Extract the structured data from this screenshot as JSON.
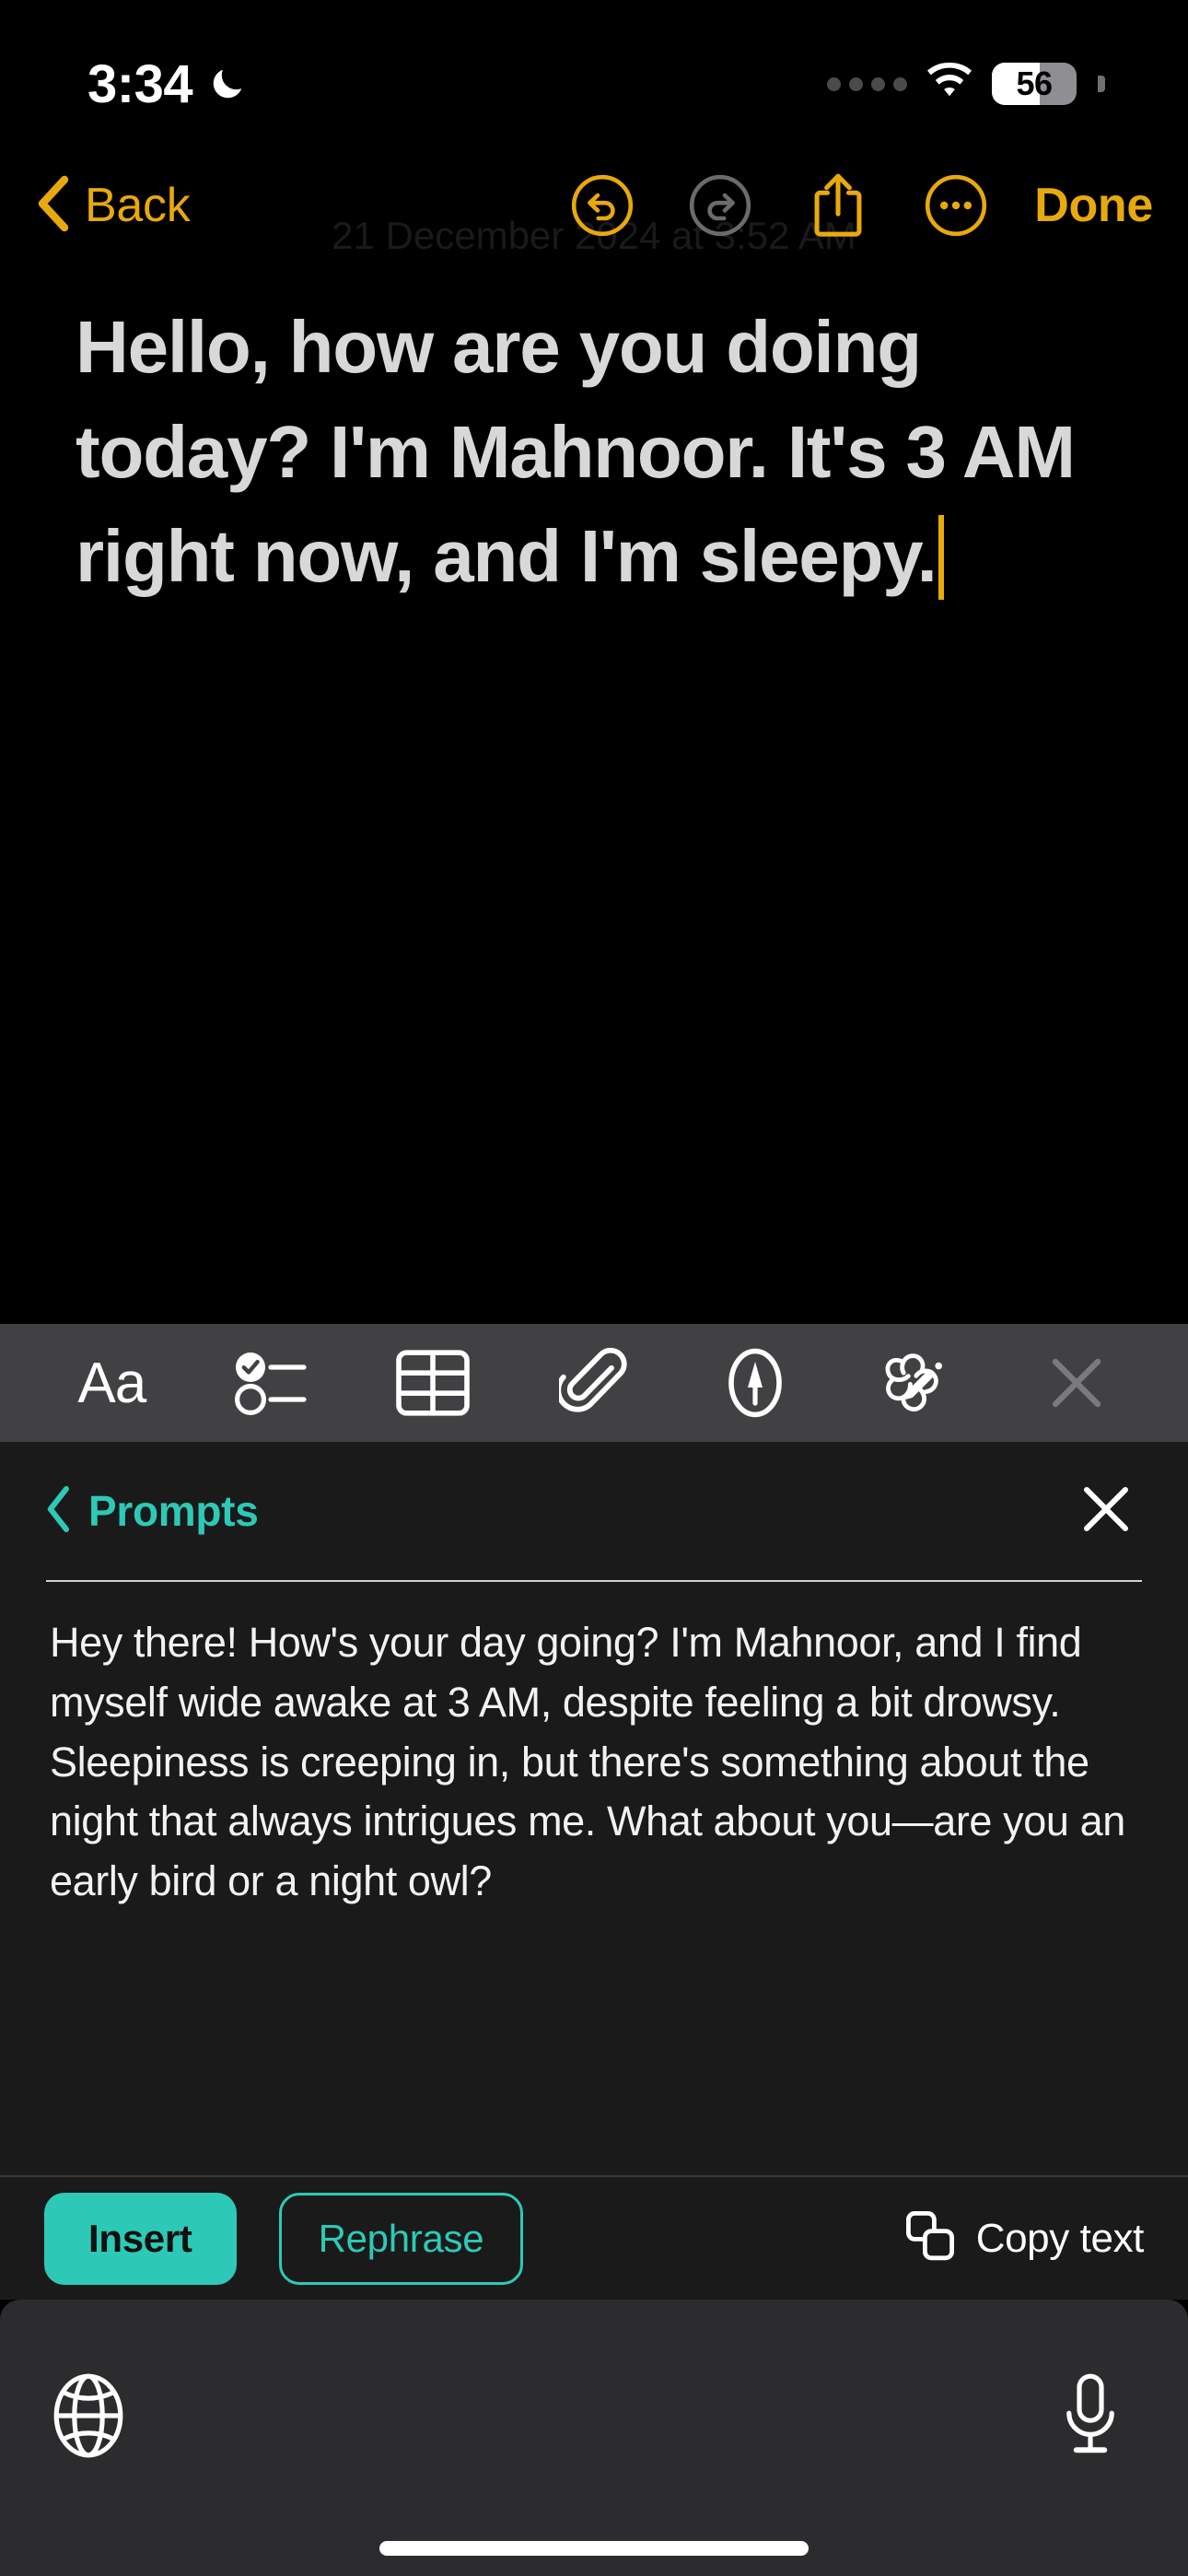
{
  "status_bar": {
    "time": "3:34",
    "do_not_disturb_icon": "moon-icon",
    "cellular_icon": "cellular-dots-icon",
    "wifi_icon": "wifi-icon",
    "battery_percent": "56",
    "battery_level": 56
  },
  "note_toolbar": {
    "back_label": "Back",
    "undo_icon": "undo-circle-icon",
    "redo_icon": "redo-circle-icon",
    "share_icon": "share-icon",
    "more_icon": "more-ellipsis-icon",
    "done_label": "Done",
    "accent_color": "#e8a90c",
    "undo_enabled": true,
    "redo_enabled": false
  },
  "note": {
    "date_stamp": "21 December 2024 at 3:52 AM",
    "body": "Hello, how are you doing today? I'm Mahnoor. It's 3 AM right now, and I'm sleepy.",
    "caret_color": "#e8a90c"
  },
  "format_toolbar": {
    "items": [
      {
        "label": "Aa",
        "icon": "text-format-icon"
      },
      {
        "label": "",
        "icon": "checklist-icon"
      },
      {
        "label": "",
        "icon": "table-icon"
      },
      {
        "label": "",
        "icon": "paperclip-icon"
      },
      {
        "label": "",
        "icon": "markup-pen-icon"
      },
      {
        "label": "",
        "icon": "scribble-ai-icon"
      },
      {
        "label": "",
        "icon": "close-icon"
      }
    ]
  },
  "prompts_panel": {
    "back_icon": "chevron-left-icon",
    "title": "Prompts",
    "close_icon": "close-icon",
    "accent_color": "#2ec9b6",
    "response_text": "Hey there! How's your day going? I'm Mahnoor, and I find myself wide awake at 3 AM, despite feeling a bit drowsy. Sleepiness is creeping in, but there's something about the night that always intrigues me. What about you—are you an early bird or a night owl?"
  },
  "action_bar": {
    "insert_label": "Insert",
    "rephrase_label": "Rephrase",
    "copy_label": "Copy text",
    "copy_icon": "copy-icon"
  },
  "keyboard_dock": {
    "globe_icon": "globe-icon",
    "mic_icon": "microphone-icon",
    "home_indicator": "home-indicator"
  }
}
